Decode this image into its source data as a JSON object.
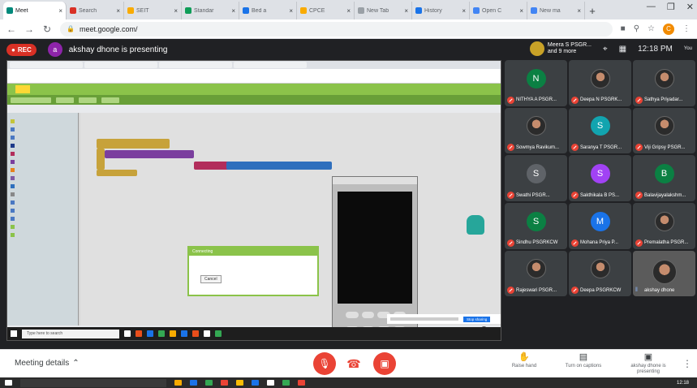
{
  "browser": {
    "tabs": [
      {
        "label": "Meet",
        "active": true,
        "color": "#00897b"
      },
      {
        "label": "Search",
        "active": false,
        "color": "#d93025"
      },
      {
        "label": "SEIT",
        "active": false,
        "color": "#f9ab00"
      },
      {
        "label": "Standar",
        "active": false,
        "color": "#0f9d58"
      },
      {
        "label": "Bed a",
        "active": false,
        "color": "#1a73e8"
      },
      {
        "label": "CPCE",
        "active": false,
        "color": "#f9ab00"
      },
      {
        "label": "New Tab",
        "active": false,
        "color": "#9aa0a6"
      },
      {
        "label": "History",
        "active": false,
        "color": "#1a73e8"
      },
      {
        "label": "Open C",
        "active": false,
        "color": "#4285f4"
      },
      {
        "label": "New ma",
        "active": false,
        "color": "#4285f4"
      }
    ],
    "url": "meet.google.com/",
    "profile_initial": "C"
  },
  "meet": {
    "rec_label": "REC",
    "presenter_initial": "a",
    "presenting_text": "akshay dhone is presenting",
    "host_line1": "Meera S PSGR...",
    "host_line2": "and 9 more",
    "time": "12:18 PM",
    "you_label": "You"
  },
  "participants": [
    {
      "name": "NITHYA A PSGR...",
      "initial": "N",
      "color": "#0b8043",
      "photo": false
    },
    {
      "name": "Deepa N PSGRK...",
      "initial": "",
      "color": "",
      "photo": true
    },
    {
      "name": "Sathya Priyadar...",
      "initial": "",
      "color": "",
      "photo": true
    },
    {
      "name": "Sowmya Ravikum...",
      "initial": "",
      "color": "",
      "photo": true
    },
    {
      "name": "Saranya T PSGR...",
      "initial": "S",
      "color": "#12a4af",
      "photo": false
    },
    {
      "name": "Viji Gripsy PSGR...",
      "initial": "",
      "color": "",
      "photo": true
    },
    {
      "name": "Swathi PSGR...",
      "initial": "S",
      "color": "#5f6368",
      "photo": false
    },
    {
      "name": "Sakthikala B PS...",
      "initial": "S",
      "color": "#a142f4",
      "photo": false
    },
    {
      "name": "Balavijayalakshm...",
      "initial": "B",
      "color": "#0b8043",
      "photo": false
    },
    {
      "name": "Sindhu PSGRKCW",
      "initial": "S",
      "color": "#0b8043",
      "photo": false
    },
    {
      "name": "Mohana Priya P...",
      "initial": "M",
      "color": "#1a73e8",
      "photo": false
    },
    {
      "name": "Premalatha PSGR...",
      "initial": "",
      "color": "",
      "photo": true
    },
    {
      "name": "Rajeswari PSGR...",
      "initial": "",
      "color": "",
      "photo": true
    },
    {
      "name": "Deepa PSGRKCW",
      "initial": "",
      "color": "",
      "photo": true
    },
    {
      "name": "akshay dhone",
      "initial": "",
      "color": "",
      "photo": true,
      "self": true
    }
  ],
  "shared_screen": {
    "dialog_title": "Connecting",
    "dialog_button": "Cancel",
    "stop_sharing": "Stop sharing",
    "taskbar_search": "Type here to search"
  },
  "controls": {
    "meeting_details": "Meeting details",
    "raise_hand": "Raise hand",
    "captions": "Turn on captions",
    "presenting": "akshay dhone is presenting",
    "clock": "12:18"
  }
}
